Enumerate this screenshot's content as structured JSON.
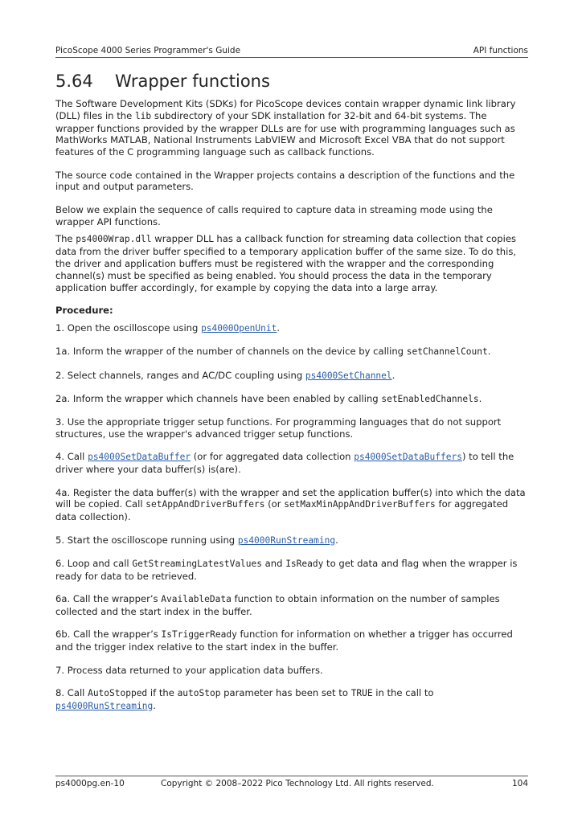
{
  "header": {
    "left": "PicoScope 4000 Series Programmer's Guide",
    "right": "API functions"
  },
  "section": {
    "number": "5.64",
    "title": "Wrapper functions"
  },
  "paragraphs": {
    "p1": [
      {
        "t": "The Software Development Kits (SDKs) for PicoScope devices contain wrapper dynamic link library (DLL) files in the "
      },
      {
        "t": "lib",
        "code": true
      },
      {
        "t": " subdirectory of your SDK installation for 32-bit and 64-bit systems. The wrapper functions provided by the wrapper DLLs are for use with programming languages such as MathWorks MATLAB, National Instruments LabVIEW and Microsoft Excel VBA that do not support features of the C programming language such as callback functions."
      }
    ],
    "p2": [
      {
        "t": "The source code contained in the Wrapper projects contains a description of the functions and the input and output parameters."
      }
    ],
    "p3": [
      {
        "t": "Below we explain the sequence of calls required to capture data in streaming mode using the wrapper API functions."
      }
    ],
    "p4": [
      {
        "t": "The "
      },
      {
        "t": "ps4000Wrap.dll",
        "code": true
      },
      {
        "t": " wrapper DLL has a callback function for streaming data collection that copies data from the driver buffer specified to a temporary application buffer of the same size. To do this, the driver and application buffers must be registered with the wrapper and the corresponding channel(s) must be specified as being enabled. You should process the data in the temporary application buffer accordingly, for example by copying the data into a large array."
      }
    ]
  },
  "procedure_label": "Procedure:",
  "steps": {
    "s1": [
      {
        "t": "1. Open the oscilloscope using "
      },
      {
        "t": "ps4000OpenUnit",
        "link": true
      },
      {
        "t": "."
      }
    ],
    "s1a": [
      {
        "t": "1a. Inform the wrapper of the number of channels on the device by calling "
      },
      {
        "t": "setChannelCount",
        "code": true
      },
      {
        "t": "."
      }
    ],
    "s2": [
      {
        "t": "2. Select channels, ranges and AC/DC coupling using "
      },
      {
        "t": "ps4000SetChannel",
        "link": true
      },
      {
        "t": "."
      }
    ],
    "s2a": [
      {
        "t": "2a. Inform the wrapper which channels have been enabled by calling "
      },
      {
        "t": "setEnabledChannels",
        "code": true
      },
      {
        "t": "."
      }
    ],
    "s3": [
      {
        "t": "3. Use the appropriate trigger setup functions. For programming languages that do not support structures, use the wrapper's advanced trigger setup functions."
      }
    ],
    "s4": [
      {
        "t": "4. Call "
      },
      {
        "t": "ps4000SetDataBuffer",
        "link": true
      },
      {
        "t": " (or for aggregated data collection "
      },
      {
        "t": "ps4000SetDataBuffers",
        "link": true
      },
      {
        "t": ") to tell the driver where your data buffer(s) is(are)."
      }
    ],
    "s4a": [
      {
        "t": "4a. Register the data buffer(s) with the wrapper and set the application buffer(s) into which the data will be copied. Call "
      },
      {
        "t": "setAppAndDriverBuffers",
        "code": true
      },
      {
        "t": " (or "
      },
      {
        "t": "setMaxMinAppAndDriverBuffers",
        "code": true
      },
      {
        "t": " for aggregated data collection)."
      }
    ],
    "s5": [
      {
        "t": "5. Start the oscilloscope running using "
      },
      {
        "t": "ps4000RunStreaming",
        "link": true
      },
      {
        "t": "."
      }
    ],
    "s6": [
      {
        "t": "6. Loop and call "
      },
      {
        "t": "GetStreamingLatestValues",
        "code": true
      },
      {
        "t": " and "
      },
      {
        "t": "IsReady",
        "code": true
      },
      {
        "t": " to get data and flag when the wrapper is ready for data to be retrieved."
      }
    ],
    "s6a": [
      {
        "t": "6a. Call the wrapper’s "
      },
      {
        "t": "AvailableData",
        "code": true
      },
      {
        "t": " function to obtain information on the number of samples collected and the start index in the buffer."
      }
    ],
    "s6b": [
      {
        "t": "6b. Call the wrapper’s "
      },
      {
        "t": "IsTriggerReady",
        "code": true
      },
      {
        "t": " function for information on whether a trigger has occurred and the trigger index relative to the start index in the buffer."
      }
    ],
    "s7": [
      {
        "t": "7. Process data returned to your application data buffers."
      }
    ],
    "s8": [
      {
        "t": "8. Call "
      },
      {
        "t": "AutoStopped",
        "code": true
      },
      {
        "t": " if the "
      },
      {
        "t": "autoStop",
        "code": true
      },
      {
        "t": " parameter has been set to "
      },
      {
        "t": "TRUE",
        "code": true
      },
      {
        "t": " in the call to "
      },
      {
        "t": "ps4000RunStreaming",
        "link": true
      },
      {
        "t": "."
      }
    ]
  },
  "footer": {
    "doc_id": "ps4000pg.en-10",
    "copyright": "Copyright © 2008–2022 Pico Technology Ltd. All rights reserved.",
    "page": "104"
  },
  "colors": {
    "link": "#2a5ca8",
    "text": "#222222"
  }
}
